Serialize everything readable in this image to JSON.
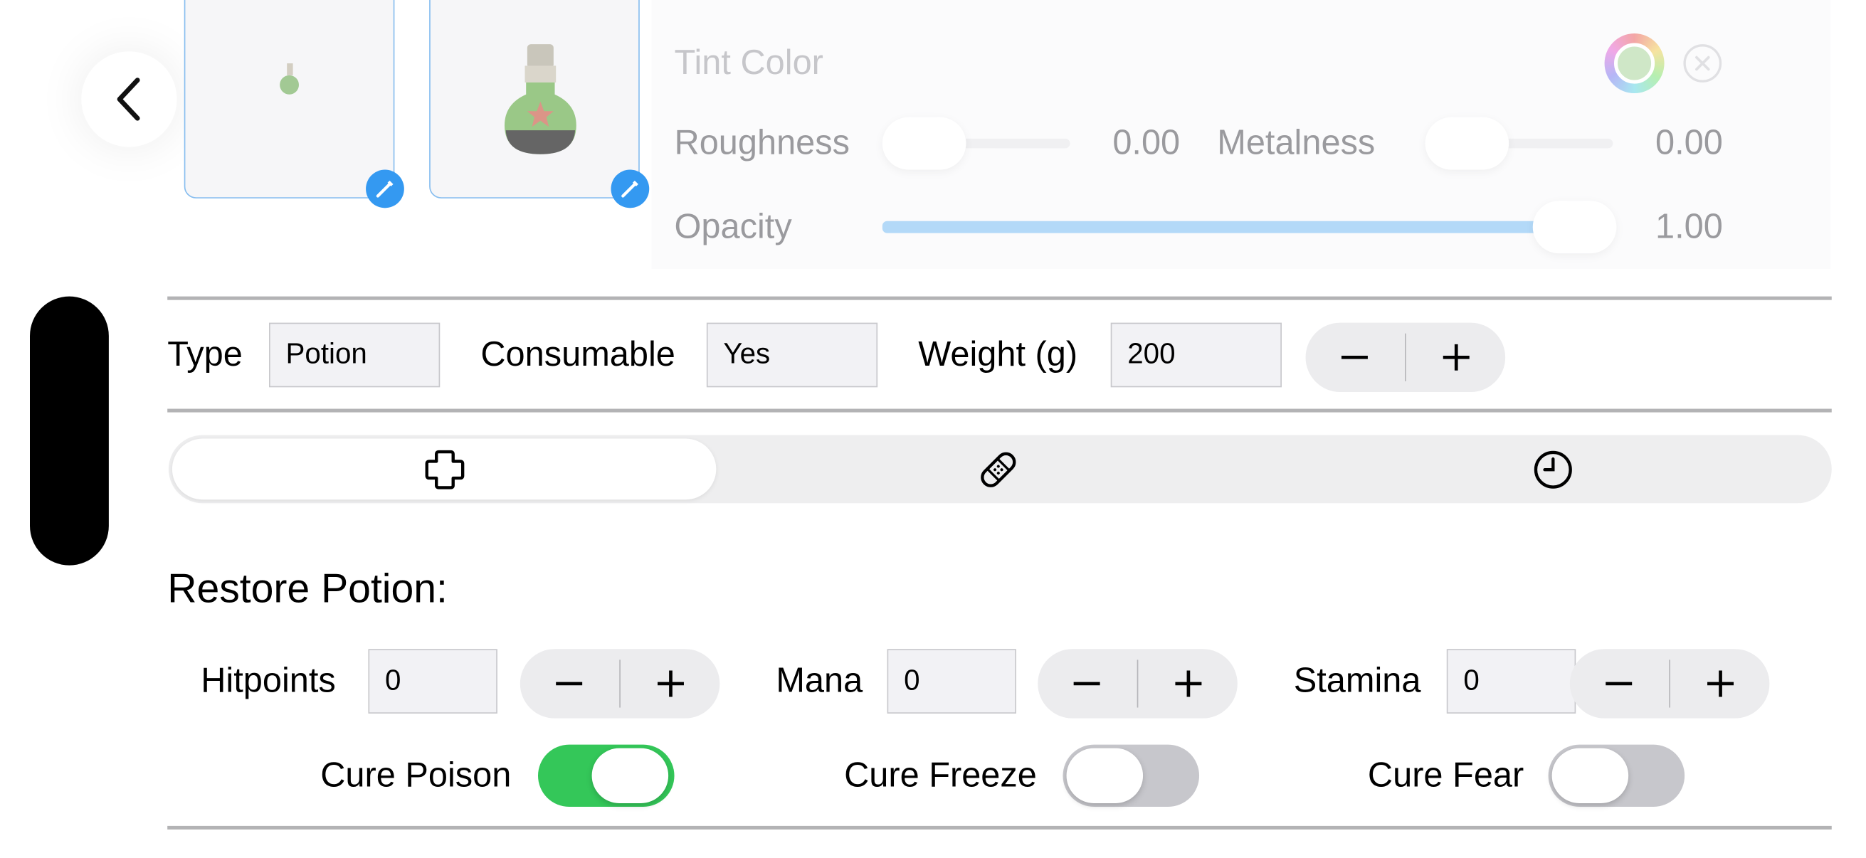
{
  "material": {
    "tint_label": "Tint Color",
    "roughness_label": "Roughness",
    "roughness_value": "0.00",
    "roughness_level": 0.0,
    "metalness_label": "Metalness",
    "metalness_value": "0.00",
    "metalness_level": 0.0,
    "opacity_label": "Opacity",
    "opacity_value": "1.00",
    "opacity_level": 1.0
  },
  "item": {
    "type_label": "Type",
    "type_value": "Potion",
    "consumable_label": "Consumable",
    "consumable_value": "Yes",
    "weight_label": "Weight (g)",
    "weight_value": "200"
  },
  "tabs": [
    {
      "icon": "cross-plus-icon",
      "selected": true
    },
    {
      "icon": "bandage-icon",
      "selected": false
    },
    {
      "icon": "clock-icon",
      "selected": false
    }
  ],
  "restore": {
    "title": "Restore Potion:",
    "hitpoints_label": "Hitpoints",
    "hitpoints_value": "0",
    "mana_label": "Mana",
    "mana_value": "0",
    "stamina_label": "Stamina",
    "stamina_value": "0",
    "cure_poison_label": "Cure Poison",
    "cure_poison_on": true,
    "cure_freeze_label": "Cure Freeze",
    "cure_freeze_on": false,
    "cure_fear_label": "Cure Fear",
    "cure_fear_on": false
  },
  "colors": {
    "accent": "#1e8ef0",
    "toggle_on": "#34c759",
    "toggle_off": "#c7c7cc",
    "opacity_fill": "#b3d9f8"
  }
}
